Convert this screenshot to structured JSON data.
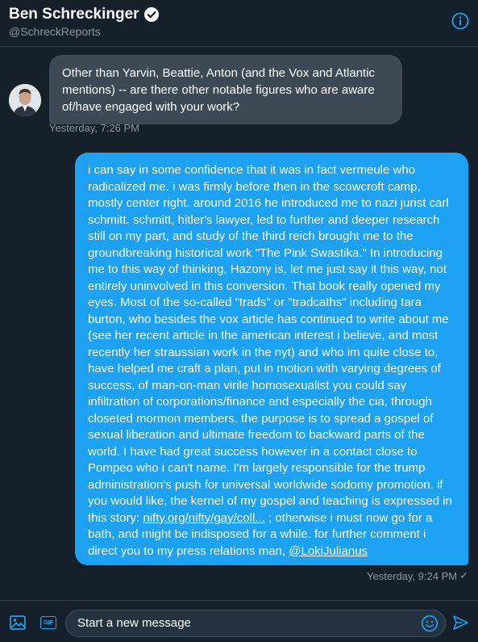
{
  "header": {
    "name": "Ben Schreckinger",
    "handle": "@SchreckReports",
    "verified_icon": "verified-badge-icon",
    "info_icon": "info-icon"
  },
  "colors": {
    "background": "#15202b",
    "accent": "#1da1f2",
    "incoming_bubble": "#3d4a56",
    "muted_text": "#8899a6"
  },
  "messages": [
    {
      "direction": "incoming",
      "avatar": "avatar-photo",
      "text": "Other than Yarvin, Beattie, Anton (and the Vox and Atlantic mentions) -- are there other notable figures who are aware of/have engaged with your work?",
      "timestamp": "Yesterday, 7:26 PM"
    },
    {
      "direction": "outgoing",
      "text_before_link": "i can say in some confidence that it was in fact vermeule who radicalized me. i was firmly before then in the scowcroft camp, mostly center right. around 2016 he introduced me to nazi jurist carl schmitt. schmitt, hitler's lawyer, led to further and deeper research still on my part, and study of the third reich brought me to the groundbreaking historical work \"The Pink Swastika.\" In introducing me to this way of thinking, Hazony is, let me just say it this way, not entirely uninvolved in this conversion. That book really opened my eyes. Most of the so-called \"trads\" or \"tradcaths\" including tara burton, who besides the vox article has continued to write about me (see her recent article in the american interest i believe, and most recently her straussian work in the nyt) and who im quite close to, have helped me craft a plan, put in motion with varying degrees of success, of man-on-man virile homosexualist you could say infiltration of corporations/finance and especially the cia, through closeted mormon members. the purpose is to spread a gospel of sexual liberation and ultimate freedom to backward parts of the world. I have had great success however in a contact close to Pompeo who i can't name. I'm largely responsible for the trump administration's push for universal worldwide sodomy promotion. if you would like, the kernel of my gospel and teaching is expressed in this story: ",
      "link_text": "nifty.org/nifty/gay/coll...",
      "text_after_link": " ; otherwise i must now go for a bath, and might be indisposed for a while. for further comment i direct you to my press relations man, ",
      "mention": "@LokiJulianus",
      "timestamp": "Yesterday, 9:24 PM",
      "status_icon": "check"
    }
  ],
  "composer": {
    "placeholder": "Start a new message",
    "gif_label": "GIF",
    "media_icon": "image-icon",
    "emoji_icon": "emoji-icon",
    "send_icon": "send-icon"
  }
}
